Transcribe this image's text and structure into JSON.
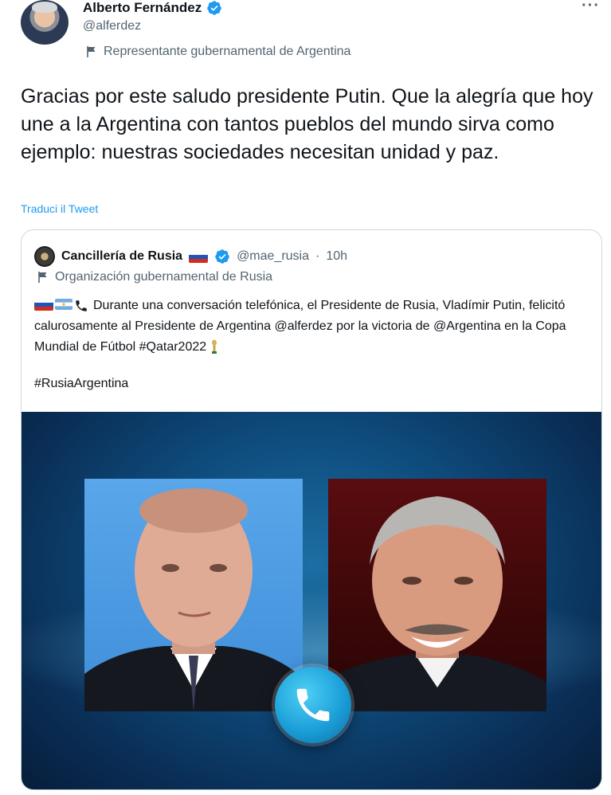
{
  "tweet": {
    "author_name": "Alberto Fernández",
    "author_handle": "@alferdez",
    "gov_label": "Representante gubernamental de Argentina",
    "text": "Gracias por este saludo presidente Putin. Que la alegría que hoy une a la Argentina con tantos pueblos del mundo sirva como ejemplo: nuestras sociedades necesitan unidad y paz.",
    "translate_link": "Traduci il Tweet",
    "more_icon": "more-icon"
  },
  "quoted": {
    "author_name": "Cancillería de Rusia",
    "author_handle": "@mae_rusia",
    "separator": "·",
    "time": "10h",
    "gov_label": "Organización gubernamental de Rusia",
    "text": "Durante una conversación telefónica, el Presidente de Rusia, Vladímir Putin, felicitó calurosamente al Presidente de Argentina @alferdez por la victoria de @Argentina en la Copa Mundial de Fútbol #Qatar2022",
    "hashtag": "#RusiaArgentina"
  },
  "colors": {
    "link": "#1d9bf0",
    "verified": "#1d9bf0",
    "secondary_text": "#536471",
    "border": "#cfd9de"
  }
}
